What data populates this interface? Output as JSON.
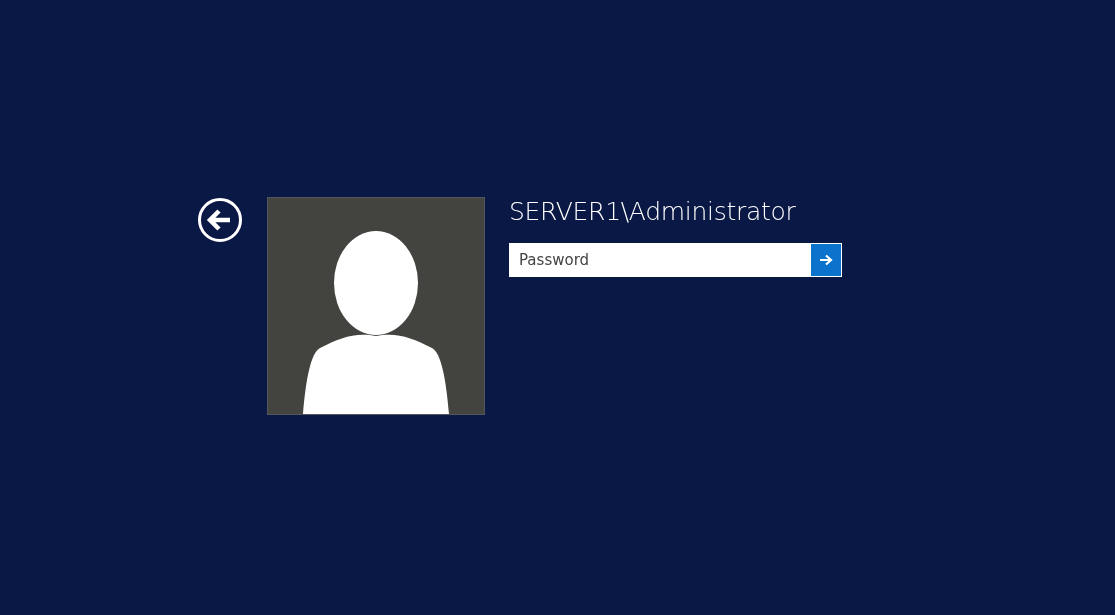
{
  "user": {
    "name": "SERVER1\\Administrator"
  },
  "password": {
    "placeholder": "Password"
  }
}
